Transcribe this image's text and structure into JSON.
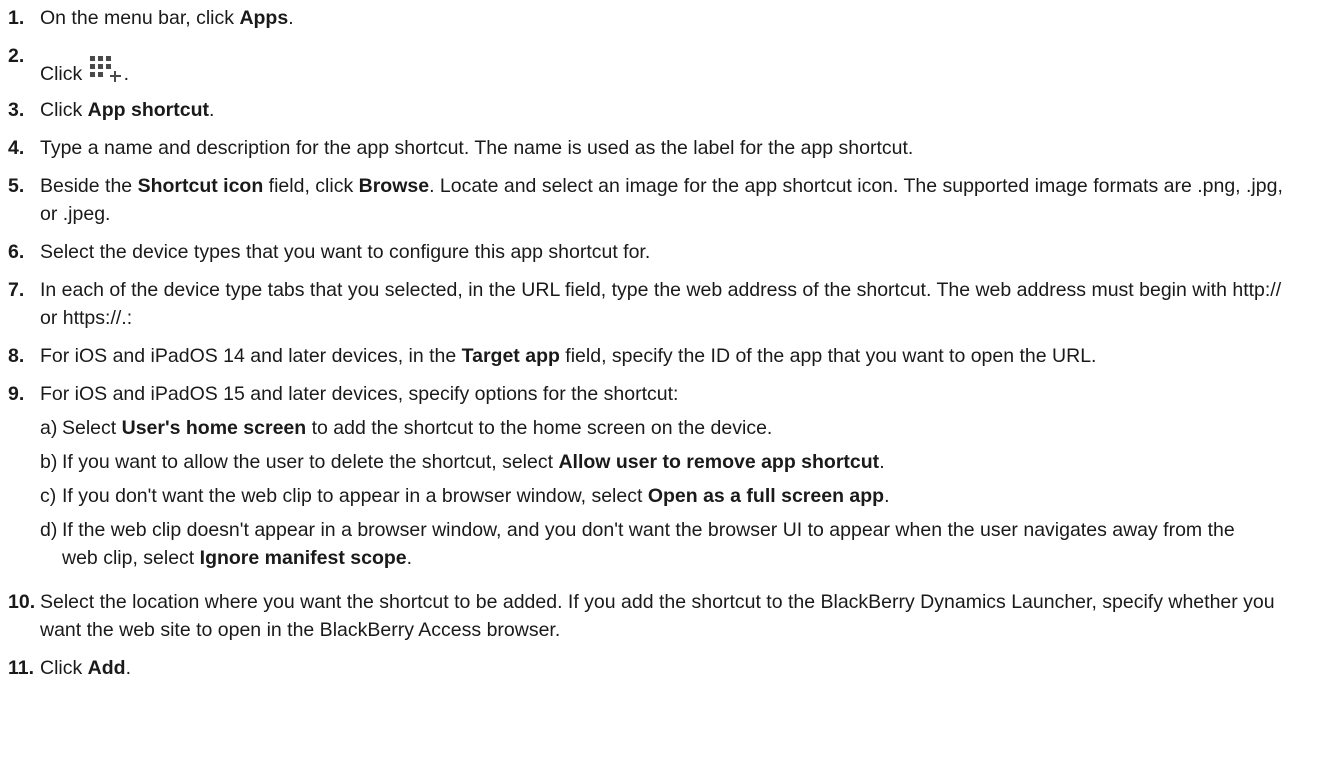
{
  "steps": [
    {
      "num": "1.",
      "parts": [
        "On the menu bar, click ",
        "Apps",
        "."
      ]
    },
    {
      "num": "2.",
      "parts": [
        "Click ",
        "."
      ],
      "icon": "add-app-grid-icon"
    },
    {
      "num": "3.",
      "parts": [
        "Click ",
        "App shortcut",
        "."
      ]
    },
    {
      "num": "4.",
      "parts": [
        "Type a name and description for the app shortcut. The name is used as the label for the app shortcut."
      ]
    },
    {
      "num": "5.",
      "parts": [
        "Beside the ",
        "Shortcut icon",
        " field, click ",
        "Browse",
        ". Locate and select an image for the app shortcut icon. The supported image formats are .png, .jpg, or .jpeg."
      ]
    },
    {
      "num": "6.",
      "parts": [
        "Select the device types that you want to configure this app shortcut for."
      ]
    },
    {
      "num": "7.",
      "parts": [
        "In each of the device type tabs that you selected, in the URL field, type the web address of the shortcut. The web address must begin with http:// or https://.:"
      ]
    },
    {
      "num": "8.",
      "parts": [
        "For iOS and iPadOS 14 and later devices, in the ",
        "Target app",
        " field, specify the ID of the app that you want to open the URL."
      ]
    },
    {
      "num": "9.",
      "parts": [
        "For iOS and iPadOS 15 and later devices, specify options for the shortcut:"
      ],
      "substeps": [
        {
          "letter": "a)",
          "parts": [
            "Select ",
            "User's home screen",
            " to add the shortcut to the home screen on the device."
          ]
        },
        {
          "letter": "b)",
          "parts": [
            "If you want to allow the user to delete the shortcut, select ",
            "Allow user to remove app shortcut",
            "."
          ]
        },
        {
          "letter": "c)",
          "parts": [
            "If you don't want the web clip to appear in a browser window, select ",
            "Open as a full screen app",
            "."
          ]
        },
        {
          "letter": "d)",
          "parts": [
            "If the web clip doesn't appear in a browser window, and you don't want the browser UI to appear when the user navigates away from the web clip, select ",
            "Ignore manifest scope",
            "."
          ]
        }
      ]
    },
    {
      "num": "10.",
      "parts": [
        "Select the location where you want the shortcut to be added. If you add the shortcut to the BlackBerry Dynamics Launcher, specify whether you want the web site to open in the BlackBerry Access browser."
      ]
    },
    {
      "num": "11.",
      "parts": [
        "Click ",
        "Add",
        "."
      ]
    }
  ]
}
